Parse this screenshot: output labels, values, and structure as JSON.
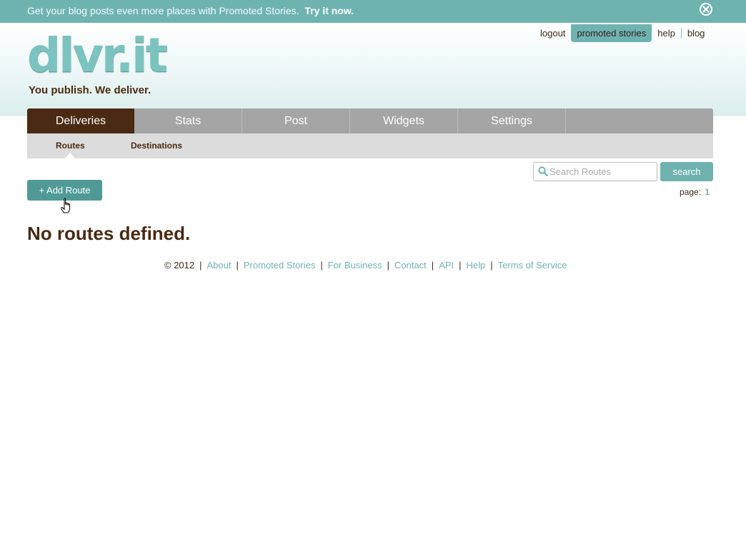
{
  "promo": {
    "text": "Get your blog posts even more places with Promoted Stories.",
    "link": "Try it now."
  },
  "brand": {
    "logo": "dlvr.it",
    "tagline": "You publish. We deliver."
  },
  "top_links": [
    "logout",
    "promoted stories",
    "help",
    "blog"
  ],
  "nav": [
    "Deliveries",
    "Stats",
    "Post",
    "Widgets",
    "Settings"
  ],
  "subnav": [
    "Routes",
    "Destinations"
  ],
  "search": {
    "placeholder": "Search Routes",
    "button": "search"
  },
  "pager": {
    "label": "page:",
    "current": "1"
  },
  "add_route": "+ Add Route",
  "empty_message": "No routes defined.",
  "footer": {
    "copyright": "© 2012",
    "links": [
      "About",
      "Promoted Stories",
      "For Business",
      "Contact",
      "API",
      "Help",
      "Terms of Service"
    ]
  },
  "colors": {
    "accent": "#6fb3b0",
    "brown": "#4a2a12",
    "nav_gray": "#a5a5a5",
    "subnav_gray": "#dcdcdc"
  }
}
